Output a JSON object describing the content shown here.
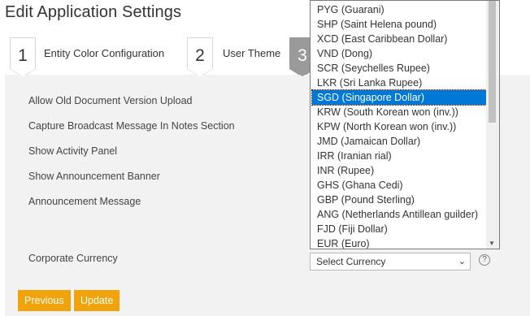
{
  "page": {
    "title": "Edit Application Settings"
  },
  "wizard": {
    "steps": [
      {
        "number": "1",
        "label": "Entity Color Configuration"
      },
      {
        "number": "2",
        "label": "User Theme"
      },
      {
        "number": "3",
        "label": ""
      }
    ]
  },
  "settings": {
    "labels": [
      "Allow Old Document Version Upload",
      "Capture Broadcast Message In Notes Section",
      "Show Activity Panel",
      "Show Announcement Banner",
      "Announcement Message"
    ],
    "currency": {
      "label": "Corporate Currency",
      "value": "Select Currency",
      "help": "?"
    }
  },
  "dropdown": {
    "options": [
      "",
      "PYG (Guarani)",
      "SHP (Saint Helena pound)",
      "XCD (East Caribbean Dollar)",
      "VND (Dong)",
      "SCR (Seychelles Rupee)",
      "LKR (Sri Lanka Rupee)",
      "SGD (Singapore Dollar)",
      "KRW (South Korean won (inv.))",
      "KPW (North Korean won (inv.))",
      "JMD (Jamaican Dollar)",
      "IRR (Iranian rial)",
      "INR (Rupee)",
      "GHS (Ghana Cedi)",
      "GBP (Pound Sterling)",
      "ANG (Netherlands Antillean guilder)",
      "FJD (Fiji Dollar)",
      "EUR (Euro)"
    ],
    "selected": "SGD (Singapore Dollar)"
  },
  "buttons": {
    "previous": "Previous",
    "update": "Update"
  },
  "colors": {
    "accent": "#f0a30a",
    "selection": "#0078d7",
    "panel": "#f2f2f2"
  }
}
